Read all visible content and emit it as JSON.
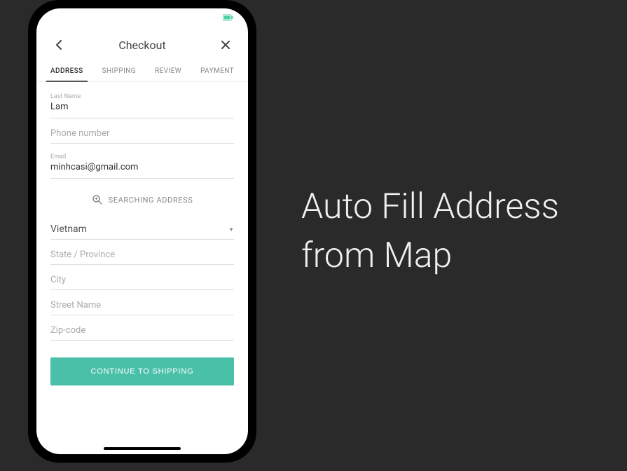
{
  "header": {
    "title": "Checkout"
  },
  "tabs": {
    "address": "ADDRESS",
    "shipping": "SHIPPING",
    "review": "REVIEW",
    "payment": "PAYMENT"
  },
  "fields": {
    "lastName": {
      "label": "Last Name",
      "value": "Lam"
    },
    "phoneNumber": {
      "placeholder": "Phone number"
    },
    "email": {
      "label": "Email",
      "value": "minhcasi@gmail.com"
    },
    "searchAddress": "SEARCHING ADDRESS",
    "country": {
      "value": "Vietnam"
    },
    "state": {
      "placeholder": "State / Province"
    },
    "city": {
      "placeholder": "City"
    },
    "streetName": {
      "placeholder": "Street Name"
    },
    "zipCode": {
      "placeholder": "Zip-code"
    }
  },
  "cta": "CONTINUE TO SHIPPING",
  "feature": {
    "line1": "Auto Fill Address",
    "line2": "from Map"
  }
}
